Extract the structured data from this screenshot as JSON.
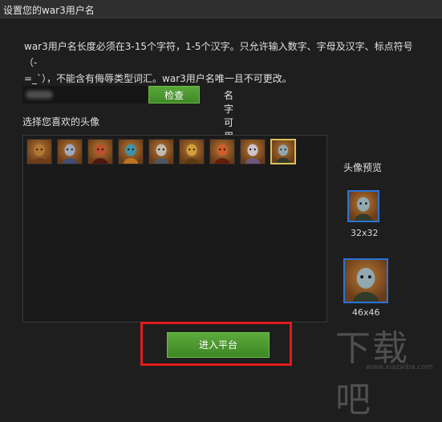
{
  "window": {
    "title": "设置您的war3用户名"
  },
  "rules": {
    "line1": "war3用户名长度必须在3-15个字符，1-5个汉字。只允许输入数字、字母及汉字、标点符号（-",
    "line2": "=_`），不能含有侮辱类型词汇。war3用户名唯一且不可更改。"
  },
  "name_field": {
    "check_label": "检查",
    "status": "名字可用"
  },
  "avatars": {
    "label": "选择您喜欢的头像",
    "items": [
      {
        "icon": "dwarf-hero-icon",
        "colors": [
          "#b57a34",
          "#6b3c18"
        ]
      },
      {
        "icon": "frost-hero-icon",
        "colors": [
          "#9fb3d8",
          "#3c4f7a"
        ]
      },
      {
        "icon": "fire-demon-icon",
        "colors": [
          "#c54a2b",
          "#4a120c"
        ]
      },
      {
        "icon": "naga-hero-icon",
        "colors": [
          "#2b9bc2",
          "#c57a22"
        ]
      },
      {
        "icon": "elf-knight-icon",
        "colors": [
          "#c9c9c9",
          "#4a5a6a"
        ]
      },
      {
        "icon": "golden-warrior-icon",
        "colors": [
          "#d9a93a",
          "#5a3a12"
        ]
      },
      {
        "icon": "red-demon-icon",
        "colors": [
          "#d85a2a",
          "#601808"
        ]
      },
      {
        "icon": "ghost-hero-icon",
        "colors": [
          "#d8d0e8",
          "#6a5a8a"
        ]
      },
      {
        "icon": "lich-hero-icon",
        "colors": [
          "#8fb4c9",
          "#2a3a2a"
        ]
      }
    ],
    "selected_index": 8
  },
  "preview": {
    "label": "头像预览",
    "small_label": "32x32",
    "large_label": "46x46"
  },
  "enter_button": {
    "label": "进入平台"
  },
  "watermark": {
    "text": "下载吧",
    "url": "www.xiazaiba.com"
  },
  "colors": {
    "accent_green": "#4a9a2e",
    "highlight_red": "#e21b1b",
    "preview_border": "#2a74d6"
  }
}
